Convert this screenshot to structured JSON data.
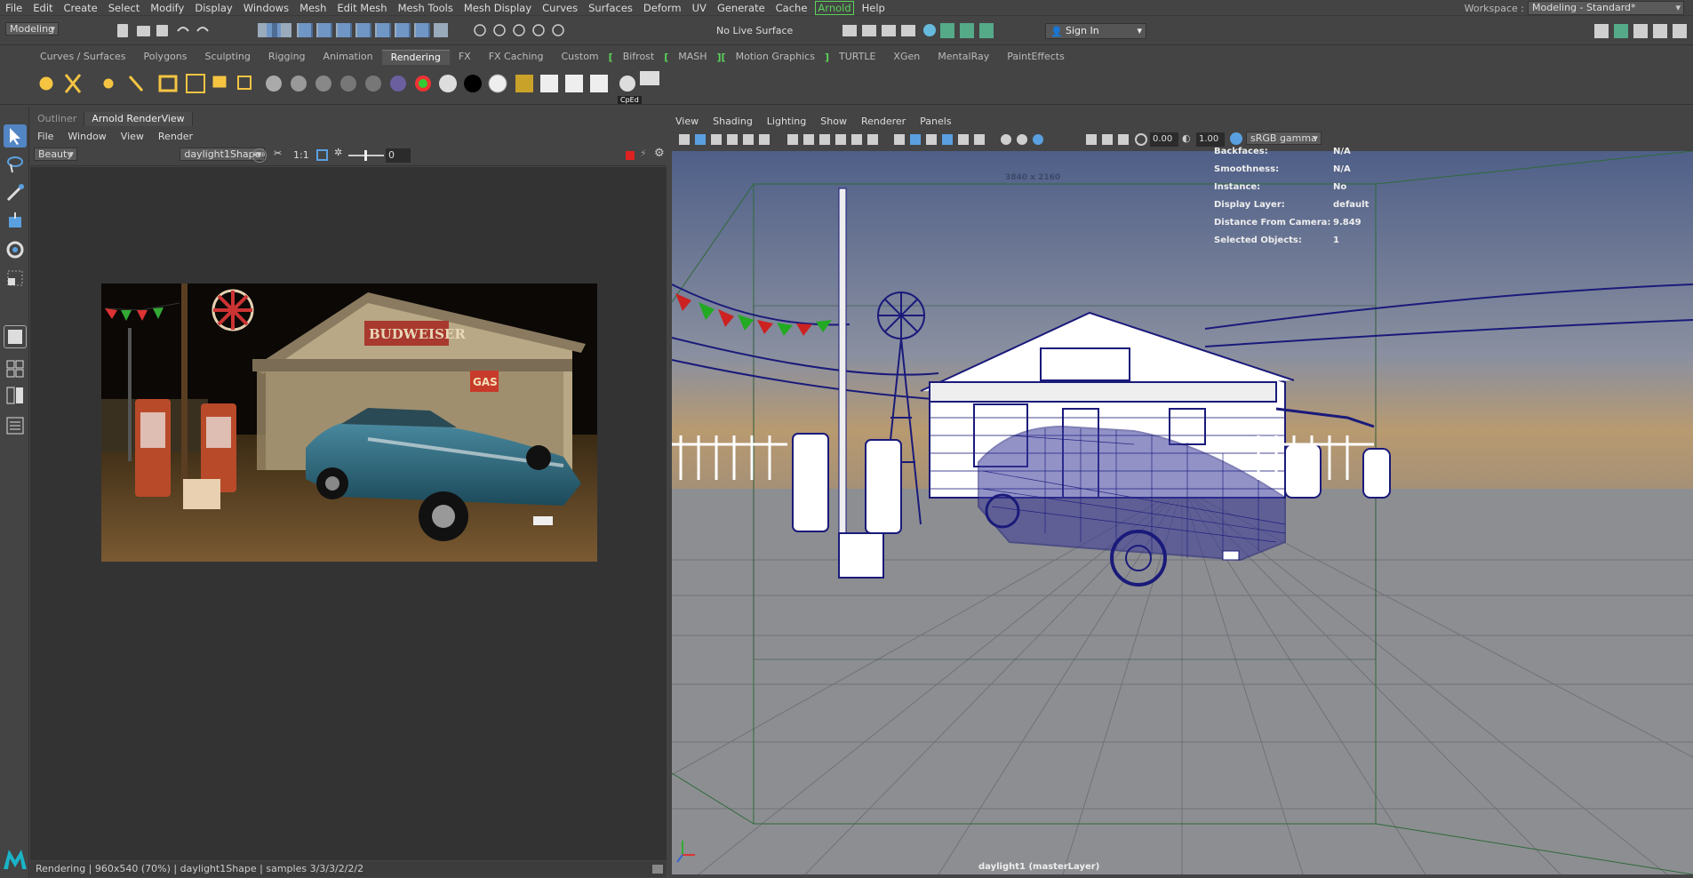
{
  "menu": [
    "File",
    "Edit",
    "Create",
    "Select",
    "Modify",
    "Display",
    "Windows",
    "Mesh",
    "Edit Mesh",
    "Mesh Tools",
    "Mesh Display",
    "Curves",
    "Surfaces",
    "Deform",
    "UV",
    "Generate",
    "Cache",
    "Arnold",
    "Help"
  ],
  "workspace": {
    "label": "Workspace :",
    "value": "Modeling - Standard*"
  },
  "status": {
    "mode": "Modeling",
    "live_surface": "No Live Surface",
    "sign_in": "Sign In"
  },
  "shelf_tabs": [
    "Curves / Surfaces",
    "Polygons",
    "Sculpting",
    "Rigging",
    "Animation",
    "Rendering",
    "FX",
    "FX Caching",
    "Custom",
    "Bifrost",
    "MASH",
    "Motion Graphics",
    "TURTLE",
    "XGen",
    "MentalRay",
    "PaintEffects"
  ],
  "shelf_active": "Rendering",
  "shelf_cped": "CpEd",
  "left_tabs": [
    "Outliner",
    "Arnold RenderView"
  ],
  "rv_menu": [
    "File",
    "Window",
    "View",
    "Render"
  ],
  "rv_aov": "Beauty",
  "rv_camera": "daylight1Shape",
  "rv_ratio": "1:1",
  "rv_exposure": "0",
  "rv_status": "Rendering | 960x540 (70%) | daylight1Shape | samples 3/3/3/2/2/2",
  "vp_menu": [
    "View",
    "Shading",
    "Lighting",
    "Show",
    "Renderer",
    "Panels"
  ],
  "vp_values": {
    "v1": "0.00",
    "v2": "1.00",
    "colorspace": "sRGB gamma"
  },
  "vp_resolution": "3840 x 2160",
  "vp_camera_label": "daylight1 (masterLayer)",
  "hud": [
    {
      "k": "Backfaces:",
      "v": "N/A"
    },
    {
      "k": "Smoothness:",
      "v": "N/A"
    },
    {
      "k": "Instance:",
      "v": "No"
    },
    {
      "k": "Display Layer:",
      "v": "default"
    },
    {
      "k": "Distance From Camera:",
      "v": "9.849"
    },
    {
      "k": "Selected Objects:",
      "v": "1"
    }
  ],
  "render_sign_text": "BUDWEISER",
  "render_gas_text": "GAS",
  "colors": {
    "accent": "#5bd35b",
    "wire": "#1a1a7a",
    "viewport_bg": "#6a6f7a"
  }
}
